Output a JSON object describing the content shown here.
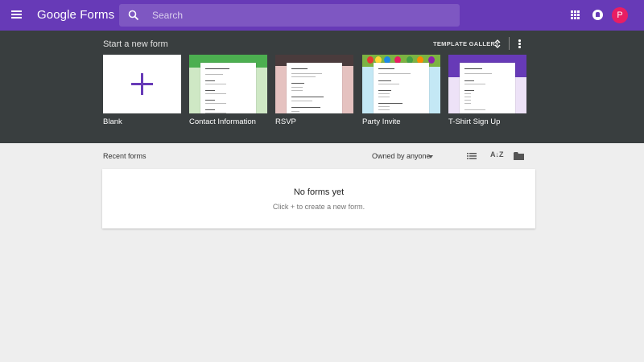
{
  "appbar": {
    "brand": "Google Forms",
    "search_placeholder": "Search",
    "avatar_letter": "P",
    "menu_icon": "hamburger-menu-icon",
    "apps_icon": "apps-grid-icon",
    "notifications_icon": "notifications-icon"
  },
  "templates": {
    "heading": "Start a new form",
    "gallery_label": "TEMPLATE GALLERY",
    "items": [
      {
        "label": "Blank"
      },
      {
        "label": "Contact Information"
      },
      {
        "label": "RSVP"
      },
      {
        "label": "Party Invite"
      },
      {
        "label": "T-Shirt Sign Up"
      }
    ]
  },
  "recent": {
    "title": "Recent forms",
    "owner_filter": "Owned by anyone",
    "empty_title": "No forms yet",
    "empty_hint": "Click + to create a new form."
  },
  "colors": {
    "brand_purple": "#673ab7",
    "search_bg": "#7e57c2",
    "template_bg": "#393e3f",
    "avatar": "#e91e63"
  }
}
